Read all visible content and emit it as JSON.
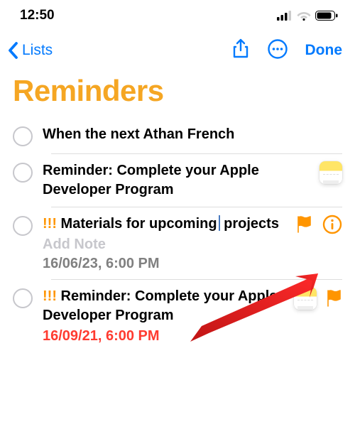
{
  "status": {
    "time": "12:50"
  },
  "nav": {
    "back_label": "Lists",
    "done_label": "Done"
  },
  "page": {
    "title": "Reminders"
  },
  "items": [
    {
      "title": "When the next Athan French"
    },
    {
      "title": "Reminder: Complete your Apple Developer Program"
    },
    {
      "priority": "!!!",
      "title": "Materials for upcoming projects",
      "note_placeholder": "Add Note",
      "date": "16/06/23, 6:00 PM"
    },
    {
      "priority": "!!!",
      "title": "Reminder: Complete your Apple Developer Program",
      "date": "16/09/21, 6:00 PM"
    }
  ]
}
